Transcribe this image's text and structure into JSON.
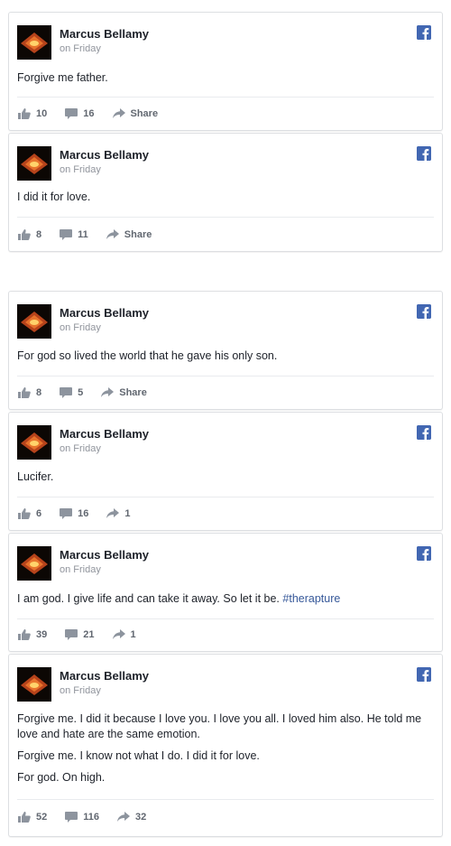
{
  "posts": [
    {
      "author": "Marcus Bellamy",
      "time": "on Friday",
      "paragraphs": [
        "Forgive me father."
      ],
      "likes": "10",
      "comments": "16",
      "share": "Share"
    },
    {
      "author": "Marcus Bellamy",
      "time": "on Friday",
      "paragraphs": [
        "I did it for love."
      ],
      "likes": "8",
      "comments": "11",
      "share": "Share"
    },
    {
      "author": "Marcus Bellamy",
      "time": "on Friday",
      "paragraphs": [
        "For god so lived the world that he gave his only son."
      ],
      "likes": "8",
      "comments": "5",
      "share": "Share"
    },
    {
      "author": "Marcus Bellamy",
      "time": "on Friday",
      "paragraphs": [
        "Lucifer."
      ],
      "likes": "6",
      "comments": "16",
      "share": "1"
    },
    {
      "author": "Marcus Bellamy",
      "time": "on Friday",
      "paragraphs": [
        "I am god. I give life and can take it away. So let it be."
      ],
      "hashtag": "#therapture",
      "likes": "39",
      "comments": "21",
      "share": "1"
    },
    {
      "author": "Marcus Bellamy",
      "time": "on Friday",
      "paragraphs": [
        "Forgive me. I did it because I love you. I love you all. I loved him also. He told me love and hate are the same emotion.",
        "Forgive me. I know not what I do. I did it for love.",
        "For god. On high."
      ],
      "likes": "52",
      "comments": "116",
      "share": "32"
    }
  ],
  "colors": {
    "facebook_blue": "#4267b2",
    "hashtag": "#365899",
    "muted": "#90949c"
  },
  "icons": [
    "like-icon",
    "comment-icon",
    "share-icon",
    "facebook-icon",
    "avatar-image"
  ]
}
